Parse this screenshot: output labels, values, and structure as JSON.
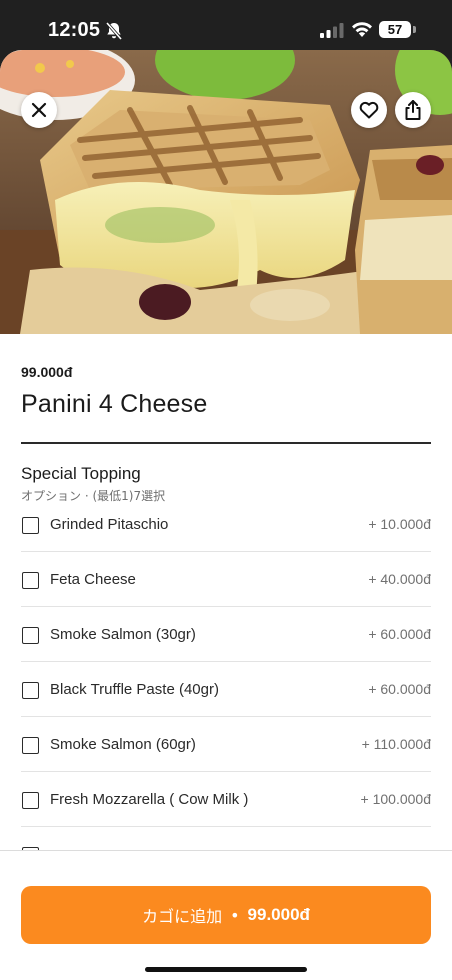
{
  "status_bar": {
    "time": "12:05",
    "battery": "57",
    "icons": [
      "bell-slash-icon",
      "signal-icon",
      "wifi-icon",
      "battery-icon"
    ]
  },
  "hero": {
    "image": "panini-photo",
    "buttons": [
      "close-icon",
      "heart-icon",
      "share-icon"
    ]
  },
  "product": {
    "price": "99.000đ",
    "name": "Panini 4 Cheese"
  },
  "topping_section": {
    "title": "Special Topping",
    "subtitle": "オプション · (最低1)7選択",
    "options": [
      {
        "name": "Grinded Pitaschio",
        "price": "+ 10.000đ"
      },
      {
        "name": "Feta Cheese",
        "price": "+ 40.000đ"
      },
      {
        "name": "Smoke Salmon (30gr)",
        "price": "+ 60.000đ"
      },
      {
        "name": "Black Truffle Paste (40gr)",
        "price": "+ 60.000đ"
      },
      {
        "name": "Smoke Salmon (60gr)",
        "price": "+ 110.000đ"
      },
      {
        "name": "Fresh Mozzarella ( Cow Milk )",
        "price": "+ 100.000đ"
      }
    ]
  },
  "cart_button": {
    "label": "カゴに追加",
    "separator": "•",
    "amount": "99.000đ"
  },
  "colors": {
    "accent": "#fb8a1f",
    "price_text": "#707070",
    "divider": "#e3e3e3"
  }
}
